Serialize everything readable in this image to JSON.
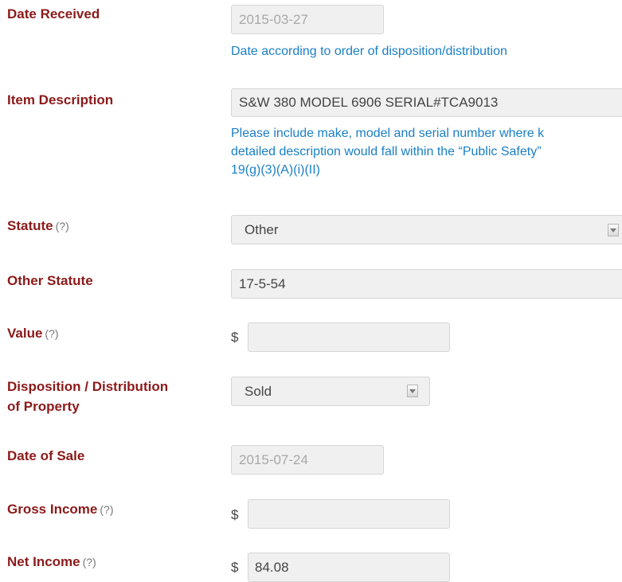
{
  "form": {
    "date_received": {
      "label": "Date Received",
      "value": "2015-03-27",
      "hint": "Date according to order of disposition/distribution"
    },
    "item_description": {
      "label": "Item Description",
      "value": "S&W 380 MODEL 6906 SERIAL#TCA9013",
      "hint_line1": "Please include make, model and serial number where k",
      "hint_line2": "detailed description would fall within the “Public Safety”",
      "hint_line3": "19(g)(3)(A)(i)(II)"
    },
    "statute": {
      "label": "Statute",
      "help": "(?)",
      "value": "Other"
    },
    "other_statute": {
      "label": "Other Statute",
      "value": "17-5-54"
    },
    "value": {
      "label": "Value",
      "help": "(?)",
      "currency": "$",
      "amount": ""
    },
    "disposition": {
      "label_line1": "Disposition / Distribution",
      "label_line2": "of Property",
      "value": "Sold"
    },
    "date_of_sale": {
      "label": "Date of Sale",
      "value": "2015-07-24"
    },
    "gross_income": {
      "label": "Gross Income",
      "help": "(?)",
      "currency": "$",
      "amount": ""
    },
    "net_income": {
      "label": "Net Income",
      "help": "(?)",
      "currency": "$",
      "amount": "84.08"
    }
  },
  "icons": {
    "select_arrow": "chevron-down-icon"
  },
  "colors": {
    "label": "#8b1a1a",
    "hint": "#1a7fc6",
    "field_bg": "#f0f0f0"
  }
}
